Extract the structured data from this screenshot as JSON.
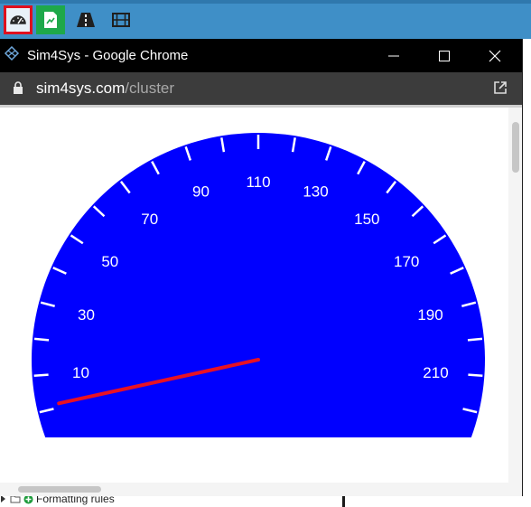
{
  "toolbar": {
    "items": [
      {
        "icon": "dashboard-icon",
        "selected": true
      },
      {
        "icon": "report-icon",
        "selected": false
      },
      {
        "icon": "road-icon",
        "selected": false
      },
      {
        "icon": "film-icon",
        "selected": false
      }
    ]
  },
  "window": {
    "title": "Sim4Sys - Google Chrome",
    "url_host": "sim4sys.com",
    "url_path": "/cluster"
  },
  "gauge": {
    "labels": [
      "10",
      "30",
      "50",
      "70",
      "90",
      "110",
      "130",
      "150",
      "170",
      "190",
      "210"
    ],
    "needle_value": 0,
    "colors": {
      "dial": "#0000ff",
      "ticks": "#ffffff",
      "needle": "#e81123"
    }
  },
  "background_tree": {
    "item_label": "Formatting rules"
  }
}
